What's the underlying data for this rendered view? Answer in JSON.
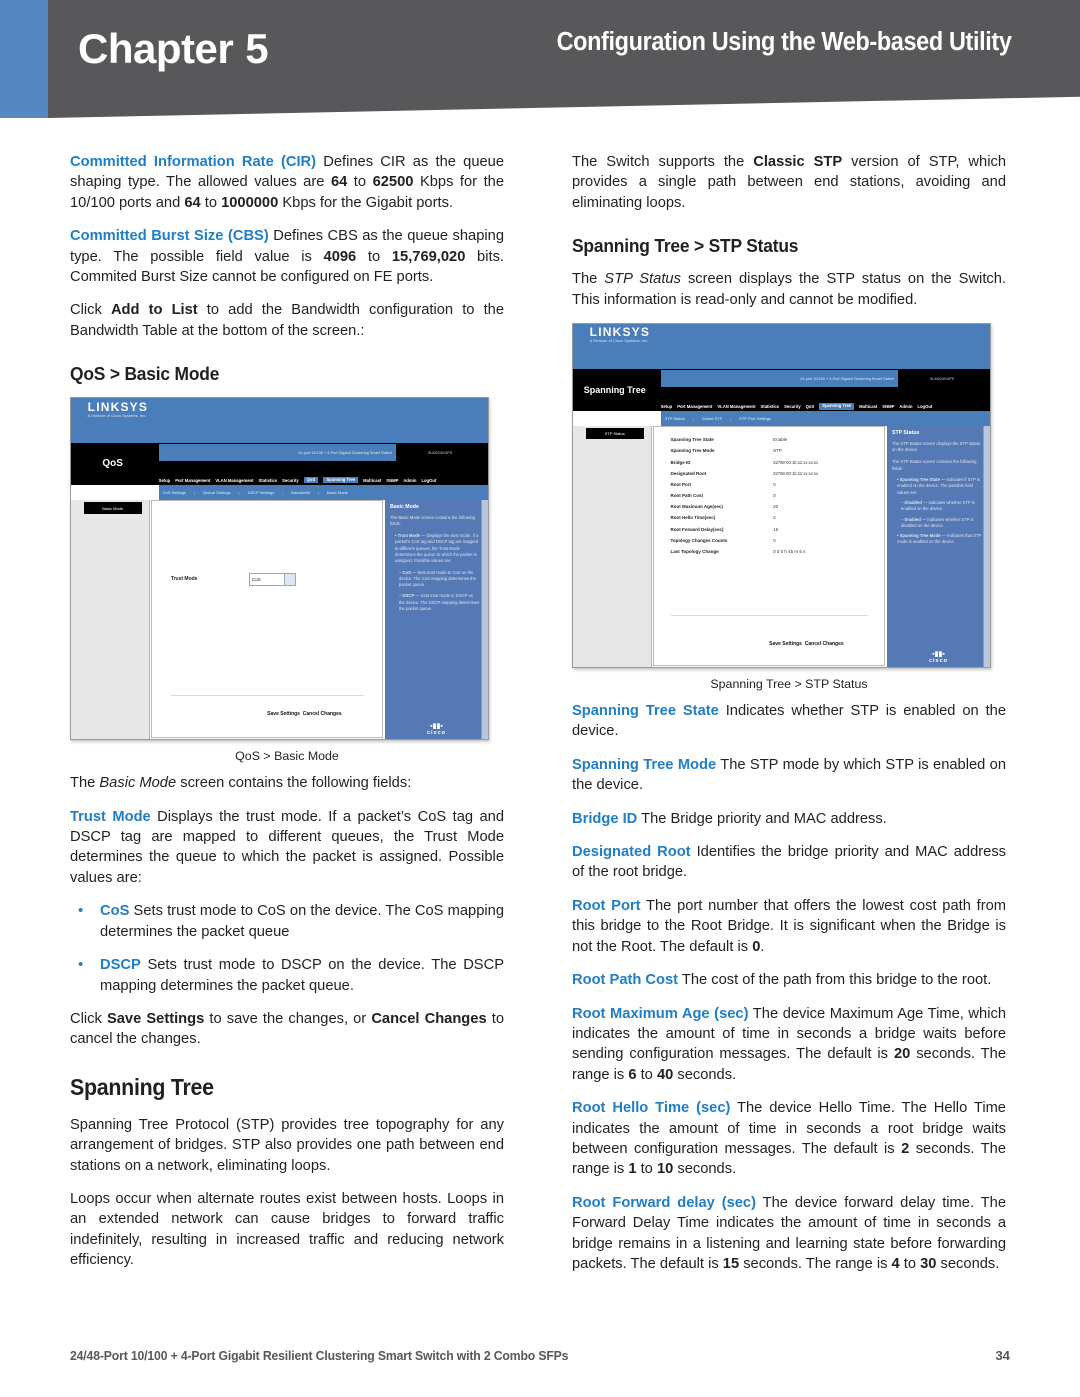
{
  "header": {
    "chapter_word": "Chapter",
    "chapter_number": "5",
    "title": "Configuration Using the Web-based Utility"
  },
  "left_column": {
    "para_cir": {
      "term": "Committed Information Rate (CIR)",
      "text_1": " Defines CIR as the queue shaping type. The allowed values are ",
      "b1": "64",
      "text_2": " to ",
      "b2": "62500",
      "text_3": " Kbps for the 10/100 ports and ",
      "b3": "64",
      "text_4": " to ",
      "b4": "1000000",
      "text_5": " Kbps for the Gigabit ports."
    },
    "para_cbs": {
      "term": "Committed Burst Size (CBS)",
      "text_1": " Defines CBS as the queue shaping type. The possible field value is ",
      "b1": "4096",
      "text_2": " to ",
      "b2": "15,769,020",
      "text_3": " bits. Commited Burst Size cannot be configured on FE ports."
    },
    "para_addtolist": {
      "text_1": "Click ",
      "b1": "Add to List",
      "text_2": " to add the Bandwidth configuration to the Bandwidth Table at the bottom of the screen.:"
    },
    "heading_qos": "QoS > Basic Mode",
    "figure_qos": {
      "caption": "QoS > Basic Mode",
      "logo": "LINKSYS",
      "logo_sub": "A Division of Cisco Systems, Inc.",
      "nav_left": "QoS",
      "model_text": "24-port 10/100 + 4-Port Gigabit Clustering Smart Switch",
      "model_id": "SLM224G4PS",
      "tabs": [
        "Setup",
        "Port Management",
        "VLAN Management",
        "Statistics",
        "Security",
        "QoS",
        "Spanning Tree",
        "Multicast",
        "SNMP",
        "Admin",
        "LogOut"
      ],
      "active_tab": "QoS",
      "subtabs": [
        "CoS Settings",
        "Queue Settings",
        "DSCP Settings",
        "Bandwidth",
        "Basic Mode"
      ],
      "sidebar_tag": "Basic Mode",
      "field_label": "Trust Mode",
      "field_value": "CoS",
      "help_title": "Basic Mode",
      "help_intro": "The Basic Mode screen contains the following fields:",
      "help_items": [
        "Trust Mode",
        "CoS",
        "DSCP"
      ],
      "save_label": "Save Settings",
      "cancel_label": "Cancel Changes",
      "brand": "cisco"
    },
    "para_basicmode": {
      "text_1": "The ",
      "i1": "Basic Mode",
      "text_2": " screen contains the following fields:"
    },
    "para_trustmode": {
      "term": "Trust Mode",
      "text_1": " Displays the trust mode. If a packet’s CoS tag and DSCP tag are mapped to different queues, the Trust Mode determines the queue to which the packet is assigned. Possible values are:"
    },
    "bullets": [
      {
        "term": "CoS",
        "text": " Sets trust mode to CoS on the device. The CoS mapping determines the packet queue"
      },
      {
        "term": "DSCP",
        "text": " Sets trust mode to DSCP on the device. The DSCP mapping determines the packet queue."
      }
    ],
    "para_save": {
      "text_1": "Click ",
      "b1": "Save Settings",
      "text_2": " to save the changes, or ",
      "b2": "Cancel Changes",
      "text_3": " to cancel the changes."
    },
    "heading_spanning_tree": "Spanning Tree",
    "para_stp_1": "Spanning Tree Protocol (STP) provides tree topography for any arrangement of bridges. STP also provides one path between end stations on a network, eliminating loops.",
    "para_stp_2": "Loops occur when alternate routes exist between hosts. Loops in an extended network can cause bridges to forward traffic indefinitely, resulting in increased traffic and reducing network efficiency."
  },
  "right_column": {
    "para_classic": {
      "text_1": "The Switch supports the ",
      "b1": "Classic STP",
      "text_2": " version of STP, which provides a single path between end stations, avoiding and eliminating loops."
    },
    "heading_stp_status": "Spanning Tree > STP Status",
    "para_stp_status": {
      "text_1": "The ",
      "i1": "STP Status",
      "text_2": " screen displays the STP status on the Switch. This information is read-only and cannot be modified."
    },
    "figure_stp": {
      "caption": "Spanning Tree > STP Status",
      "logo": "LINKSYS",
      "logo_sub": "A Division of Cisco Systems, Inc.",
      "nav_left": "Spanning Tree",
      "model_text": "24-port 10/100 + 4-Port Gigabit Clustering Smart Switch",
      "model_id": "SLM224G4PS",
      "tabs": [
        "Setup",
        "Port Management",
        "VLAN Management",
        "Statistics",
        "Security",
        "QoS",
        "Spanning Tree",
        "Multicast",
        "SNMP",
        "Admin",
        "LogOut"
      ],
      "active_tab": "Spanning Tree",
      "subtabs": [
        "STP Status",
        "Global STP",
        "STP Port Settings"
      ],
      "sidebar_tag": "STP Status",
      "rows": [
        {
          "label": "Spanning Tree State",
          "value": "Enable"
        },
        {
          "label": "Spanning Tree Mode",
          "value": "STP"
        },
        {
          "label": "Bridge ID",
          "value": "32768-00:1b:11:xx:xx:xx"
        },
        {
          "label": "Designated Root",
          "value": "32768-00:1b:11:xx:xx:xx"
        },
        {
          "label": "Root Port",
          "value": "0"
        },
        {
          "label": "Root Path Cost",
          "value": "0"
        },
        {
          "label": "Root Maximum Age(sec)",
          "value": "20"
        },
        {
          "label": "Root Hello Time(sec)",
          "value": "2"
        },
        {
          "label": "Root Forward Delay(sec)",
          "value": "15"
        },
        {
          "label": "Topology Changes Counts",
          "value": "0"
        },
        {
          "label": "Last Topology Change",
          "value": "0 d 0 h 45 m 5 s"
        }
      ],
      "help_title": "STP Status",
      "help_intro": "The STP Status screen displays the STP status on the device.",
      "help_items": [
        "Spanning Tree State",
        "Disabled",
        "Enabled",
        "Spanning Tree Mode"
      ],
      "save_label": "Save Settings",
      "cancel_label": "Cancel Changes",
      "brand": "cisco"
    },
    "terms": [
      {
        "term": "Spanning Tree State",
        "text": " Indicates whether STP is enabled on the device."
      },
      {
        "term": "Spanning Tree Mode",
        "text": " The STP mode by which STP is enabled on the device."
      },
      {
        "term": "Bridge ID",
        "text": " The Bridge priority and MAC address."
      },
      {
        "term": "Designated Root",
        "text": " Identifies the bridge priority and MAC address of the root bridge."
      }
    ],
    "para_root_port": {
      "term": "Root Port",
      "text_1": " The port number that offers the lowest cost path from this bridge to the Root Bridge. It is significant when the Bridge is not the Root. The default is ",
      "b1": "0",
      "text_2": "."
    },
    "para_root_path_cost": {
      "term": "Root Path Cost",
      "text_1": " The cost of the path from this bridge to the root."
    },
    "para_root_max_age": {
      "term": "Root Maximum Age (sec)",
      "text_1": " The device Maximum Age Time, which indicates the amount of time in seconds a bridge waits before sending configuration messages. The default is ",
      "b1": "20",
      "text_2": " seconds. The range is ",
      "b2": "6",
      "text_3": " to ",
      "b3": "40",
      "text_4": " seconds."
    },
    "para_root_hello": {
      "term": "Root Hello Time (sec)",
      "text_1": " The device Hello Time. The Hello Time indicates the amount of time in seconds a root bridge waits between configuration messages. The default is ",
      "b1": "2",
      "text_2": " seconds. The range is ",
      "b2": "1",
      "text_3": " to ",
      "b3": "10",
      "text_4": " seconds."
    },
    "para_root_forward": {
      "term": "Root Forward delay (sec)",
      "text_1": " The device forward delay time. The Forward Delay Time indicates the amount of time in seconds a bridge remains in a listening and learning state before forwarding packets. The default is ",
      "b1": "15",
      "text_2": " seconds. The range is ",
      "b2": "4",
      "text_3": " to ",
      "b3": "30",
      "text_4": " seconds."
    }
  },
  "footer": {
    "product": "24/48-Port 10/100 + 4-Port Gigabit Resilient Clustering Smart Switch with 2 Combo SFPs",
    "page": "34"
  },
  "colors": {
    "term_blue": "#1f7ec4",
    "header_gray": "#58585a",
    "accent_blue": "#5588c2",
    "ui_blue": "#4a7ebb"
  }
}
